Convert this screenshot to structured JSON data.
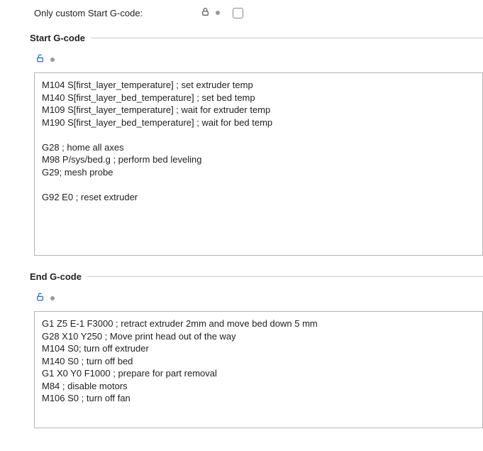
{
  "top": {
    "label": "Only custom Start G-code:"
  },
  "start": {
    "legend": "Start G-code",
    "code": "M104 S[first_layer_temperature] ; set extruder temp\nM140 S[first_layer_bed_temperature] ; set bed temp\nM109 S[first_layer_temperature] ; wait for extruder temp\nM190 S[first_layer_bed_temperature] ; wait for bed temp\n\nG28 ; home all axes\nM98 P/sys/bed.g ; perform bed leveling\nG29; mesh probe\n\nG92 E0 ; reset extruder\n"
  },
  "end": {
    "legend": "End G-code",
    "code": "G1 Z5 E-1 F3000 ; retract extruder 2mm and move bed down 5 mm\nG28 X10 Y250 ; Move print head out of the way\nM104 S0; turn off extruder\nM140 S0 ; turn off bed\nG1 X0 Y0 F1000 ; prepare for part removal\nM84 ; disable motors\nM106 S0 ; turn off fan"
  }
}
